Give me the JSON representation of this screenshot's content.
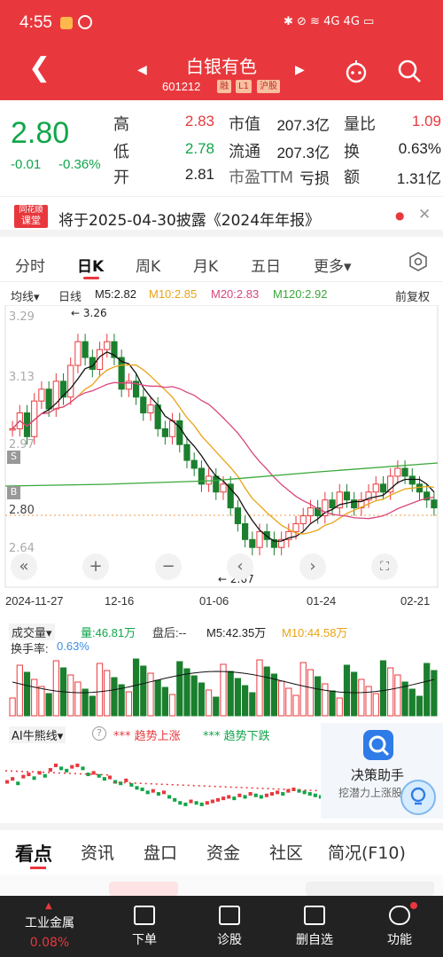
{
  "statusbar": {
    "time": "4:55",
    "icons": "✱ ⊘ ≋ 4G 4G ▭"
  },
  "header": {
    "title": "白银有色",
    "code": "601212",
    "tags": [
      "融",
      "L1",
      "沪股"
    ]
  },
  "quote": {
    "price": "2.80",
    "change": "-0.01",
    "change_pct": "-0.36%",
    "rows": [
      {
        "l1": "高",
        "v1": "2.83",
        "l2": "市值",
        "v2": "207.3亿",
        "l3": "量比",
        "v3": "1.09"
      },
      {
        "l1": "低",
        "v1": "2.78",
        "l2": "流通",
        "v2": "207.3亿",
        "l3": "换",
        "v3": "0.63%"
      },
      {
        "l1": "开",
        "v1": "2.81",
        "l2": "市盈TTM",
        "v2": "亏损",
        "l3": "额",
        "v3": "1.31亿"
      }
    ]
  },
  "notice": {
    "logo_top": "同花顺",
    "logo_bottom": "课堂",
    "text": "将于2025-04-30披露《2024年年报》"
  },
  "tabs": [
    "分时",
    "日K",
    "周K",
    "月K",
    "五日",
    "更多▾"
  ],
  "ma": {
    "type": "均线▾",
    "period": "日线",
    "m5": "M5:2.82",
    "m10": "M10:2.85",
    "m20": "M20:2.83",
    "m120": "M120:2.92",
    "adj": "前复权"
  },
  "chart": {
    "yticks": [
      "3.29",
      "3.13",
      "2.97",
      "2.80",
      "2.64"
    ],
    "high_label": "3.26",
    "low_label": "2.67",
    "dates": [
      "2024-11-27",
      "12-16",
      "01-06",
      "01-24",
      "02-21"
    ]
  },
  "volume": {
    "type": "成交量▾",
    "vol": "量:46.81万",
    "after": "盘后:--",
    "m5": "M5:42.35万",
    "m10": "M10:44.58万",
    "turnover_label": "换手率:",
    "turnover": "0.63%"
  },
  "ai": {
    "type": "AI牛熊线▾",
    "up": "趋势上涨",
    "down": "趋势下跌",
    "assistant": "决策助手",
    "assistant_sub": "挖潜力上涨股"
  },
  "bottom_tabs": [
    "看点",
    "资讯",
    "盘口",
    "资金",
    "社区",
    "简况(F10)"
  ],
  "nav": [
    {
      "label": "工业金属",
      "sub": "0.08%"
    },
    {
      "label": "下单"
    },
    {
      "label": "诊股"
    },
    {
      "label": "删自选"
    },
    {
      "label": "功能"
    }
  ],
  "chart_data": {
    "type": "candlestick",
    "x_start": "2024-11-27",
    "x_end": "2025-02-21",
    "ylim": [
      2.64,
      3.29
    ],
    "high": 3.26,
    "low": 2.67,
    "close": [
      3.0,
      3.04,
      2.98,
      3.07,
      3.1,
      3.05,
      3.12,
      3.08,
      3.16,
      3.22,
      3.18,
      3.15,
      3.2,
      3.22,
      3.18,
      3.1,
      3.12,
      3.08,
      3.04,
      3.06,
      3.0,
      2.98,
      3.02,
      2.96,
      2.92,
      2.9,
      2.86,
      2.88,
      2.84,
      2.86,
      2.8,
      2.76,
      2.72,
      2.7,
      2.74,
      2.72,
      2.7,
      2.72,
      2.74,
      2.76,
      2.78,
      2.8,
      2.78,
      2.82,
      2.8,
      2.84,
      2.82,
      2.8,
      2.82,
      2.84,
      2.86,
      2.84,
      2.88,
      2.9,
      2.88,
      2.86,
      2.84,
      2.82,
      2.8
    ]
  }
}
